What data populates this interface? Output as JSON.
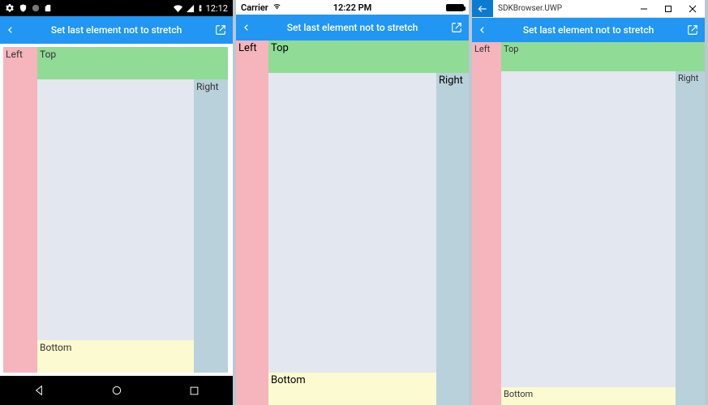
{
  "header": {
    "title": "Set last element not to stretch"
  },
  "dock": {
    "left": "Left",
    "top": "Top",
    "right": "Right",
    "bottom": "Bottom"
  },
  "android": {
    "clock": "12:12"
  },
  "ios": {
    "carrier": "Carrier",
    "clock": "12:22 PM"
  },
  "uwp": {
    "window_title": "SDKBrowser.UWP"
  }
}
